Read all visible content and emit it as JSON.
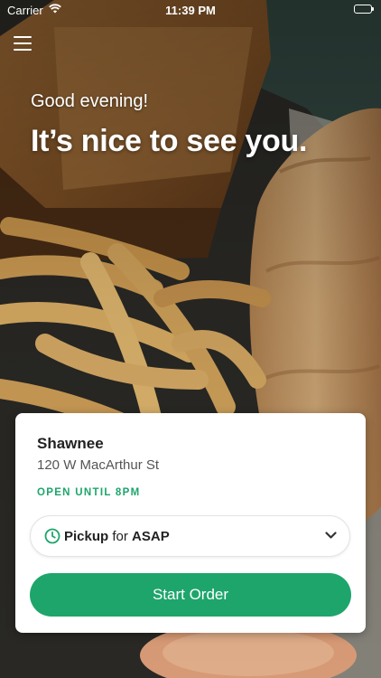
{
  "status_bar": {
    "carrier": "Carrier",
    "time": "11:39 PM"
  },
  "hero": {
    "greeting": "Good evening!",
    "headline": "It’s nice to see you.",
    "image_description": "food-photo"
  },
  "store_card": {
    "name": "Shawnee",
    "address": "120 W MacArthur St",
    "hours": "OPEN UNTIL 8PM",
    "order_mode": "Pickup",
    "order_mode_connector": "for",
    "order_time": "ASAP",
    "start_button": "Start Order"
  },
  "icons": {
    "menu": "hamburger-menu-icon",
    "clock": "clock-icon",
    "chevron": "chevron-down-icon",
    "wifi": "wifi-icon",
    "battery": "battery-icon"
  },
  "colors": {
    "accent": "#1ea56b",
    "card": "#ffffff",
    "text_dark": "#222222"
  }
}
